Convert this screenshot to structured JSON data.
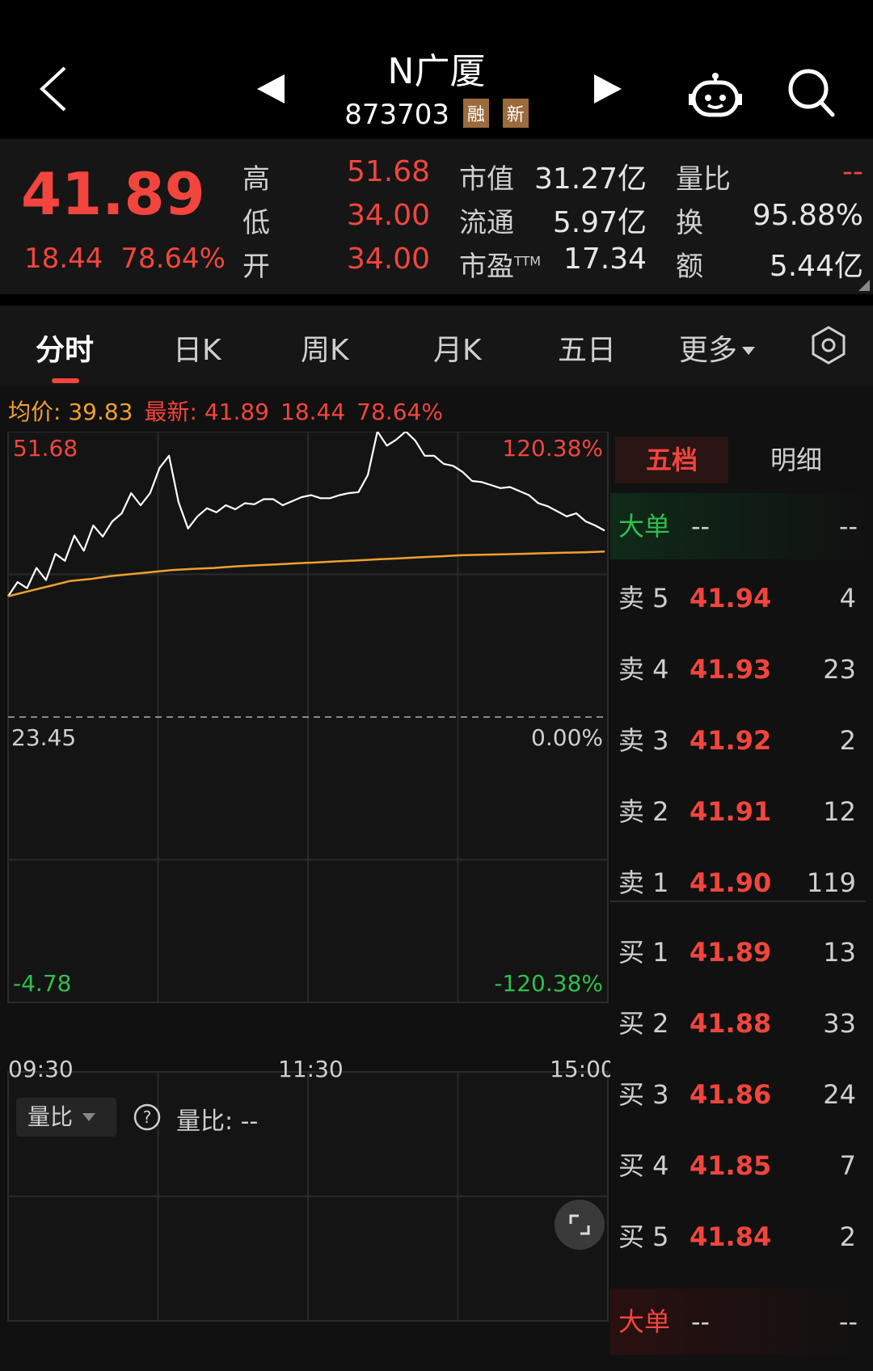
{
  "header": {
    "title": "N广厦",
    "code": "873703",
    "tags": [
      "融",
      "新"
    ]
  },
  "quote": {
    "price": "41.89",
    "change": "18.44",
    "change_pct": "78.64%",
    "high_label": "高",
    "high": "51.68",
    "low_label": "低",
    "low": "34.00",
    "open_label": "开",
    "open": "34.00",
    "mktcap_label": "市值",
    "mktcap": "31.27亿",
    "float_label": "流通",
    "float": "5.97亿",
    "pe_label": "市盈",
    "pe_sup": "TTM",
    "pe": "17.34",
    "volratio_label": "量比",
    "volratio": "--",
    "turnover_label": "换",
    "turnover": "95.88%",
    "amount_label": "额",
    "amount": "5.44亿"
  },
  "tabs": [
    "分时",
    "日K",
    "周K",
    "月K",
    "五日",
    "更多"
  ],
  "chart_info": {
    "avg_label": "均价: 39.83",
    "latest_label": "最新: 41.89",
    "latest_change": "18.44",
    "latest_pct": "78.64%"
  },
  "chart_data": {
    "type": "line",
    "ylim": [
      -4.78,
      51.68
    ],
    "y_ticks_left": [
      "51.68",
      "23.45",
      "-4.78"
    ],
    "y_ticks_right": [
      "120.38%",
      "0.00%",
      "-120.38%"
    ],
    "baseline": 23.45,
    "x_ticks": [
      "09:30",
      "11:30",
      "15:00"
    ],
    "series": [
      {
        "values": [
          35.4,
          36.8,
          36.2,
          38.2,
          37.0,
          39.6,
          38.9,
          41.4,
          39.9,
          42.4,
          41.3,
          42.8,
          43.6,
          45.6,
          44.4,
          45.6,
          48.1,
          49.3,
          44.7,
          42.1,
          43.3,
          44.1,
          43.7,
          44.4,
          44.0,
          44.6,
          44.5,
          45.0,
          45.0,
          44.4,
          44.8,
          45.2,
          45.4,
          45.1,
          45.1,
          45.4,
          45.6,
          45.7,
          47.4,
          51.7,
          50.3,
          50.9,
          51.7,
          50.8,
          49.3,
          49.3,
          48.5,
          48.3,
          47.7,
          46.8,
          46.7,
          46.4,
          46.1,
          46.2,
          45.8,
          45.4,
          44.6,
          44.3,
          43.8,
          43.3,
          43.6,
          42.8,
          42.4,
          41.89
        ],
        "color": "#ffffff"
      },
      {
        "values": [
          35.4,
          35.9,
          36.4,
          36.9,
          37.1,
          37.4,
          37.6,
          37.8,
          38.0,
          38.1,
          38.2,
          38.35,
          38.45,
          38.55,
          38.65,
          38.75,
          38.85,
          38.95,
          39.05,
          39.15,
          39.25,
          39.35,
          39.45,
          39.5,
          39.55,
          39.6,
          39.65,
          39.7,
          39.75,
          39.83
        ],
        "color": "#f0a030"
      }
    ]
  },
  "volume_panel": {
    "selector": "量比",
    "label": "量比: --"
  },
  "orderbook": {
    "tabs": [
      "五档",
      "明细"
    ],
    "big_label": "大单",
    "big_v1": "--",
    "big_v2": "--",
    "asks": [
      {
        "label": "卖 5",
        "price": "41.94",
        "qty": "4"
      },
      {
        "label": "卖 4",
        "price": "41.93",
        "qty": "23"
      },
      {
        "label": "卖 3",
        "price": "41.92",
        "qty": "2"
      },
      {
        "label": "卖 2",
        "price": "41.91",
        "qty": "12"
      },
      {
        "label": "卖 1",
        "price": "41.90",
        "qty": "119"
      }
    ],
    "bids": [
      {
        "label": "买 1",
        "price": "41.89",
        "qty": "13"
      },
      {
        "label": "买 2",
        "price": "41.88",
        "qty": "33"
      },
      {
        "label": "买 3",
        "price": "41.86",
        "qty": "24"
      },
      {
        "label": "买 4",
        "price": "41.85",
        "qty": "7"
      },
      {
        "label": "买 5",
        "price": "41.84",
        "qty": "2"
      }
    ]
  },
  "colors": {
    "up": "#f2453d",
    "down": "#2fbf4a",
    "avg_line": "#f0a030"
  }
}
